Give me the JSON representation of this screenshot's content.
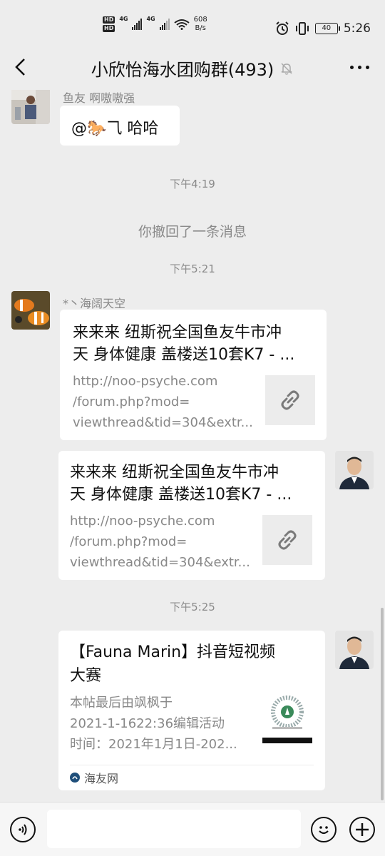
{
  "status_bar": {
    "hd_badges": [
      "HD",
      "HD"
    ],
    "net1": "4G",
    "net2": "4G",
    "speed_value": "608",
    "speed_unit": "B/s",
    "battery": "40",
    "time": "5:26"
  },
  "header": {
    "title": "小欣怡海水团购群(493)",
    "back_icon": "chevron-left-icon",
    "mute_icon": "bell-off-icon",
    "more_icon": "more-dots-icon"
  },
  "messages": {
    "msg1": {
      "sender": "鱼友 啊嗷嗷强",
      "text": "@🐎⺄ 哈哈"
    },
    "time1": "下午4:19",
    "recall_text": "你撤回了一条消息",
    "time2": "下午5:21",
    "msg2": {
      "sender": "*丶海阔天空",
      "title_line1": "来来来 纽斯祝全国鱼友牛市冲",
      "title_line2": "天 身体健康 盖楼送10套K7 - ...",
      "desc_line1": "http://noo-psyche.com",
      "desc_line2": "/forum.php?mod=",
      "desc_line3": "viewthread&tid=304&extr..."
    },
    "msg3": {
      "title_line1": "来来来 纽斯祝全国鱼友牛市冲",
      "title_line2": "天 身体健康 盖楼送10套K7 - ...",
      "desc_line1": "http://noo-psyche.com",
      "desc_line2": "/forum.php?mod=",
      "desc_line3": "viewthread&tid=304&extr..."
    },
    "time3": "下午5:25",
    "msg4": {
      "title_line1": "【Fauna Marin】抖音短视频",
      "title_line2": "大赛",
      "desc_line1": "本帖最后由飒枫于",
      "desc_line2": "2021-1-1622:36编辑活动",
      "desc_line3": "时间：2021年1月1日-202...",
      "source": "海友网"
    }
  },
  "colors": {
    "background": "#ededed",
    "bubble": "#ffffff",
    "meta_text": "#8a8a8a"
  }
}
